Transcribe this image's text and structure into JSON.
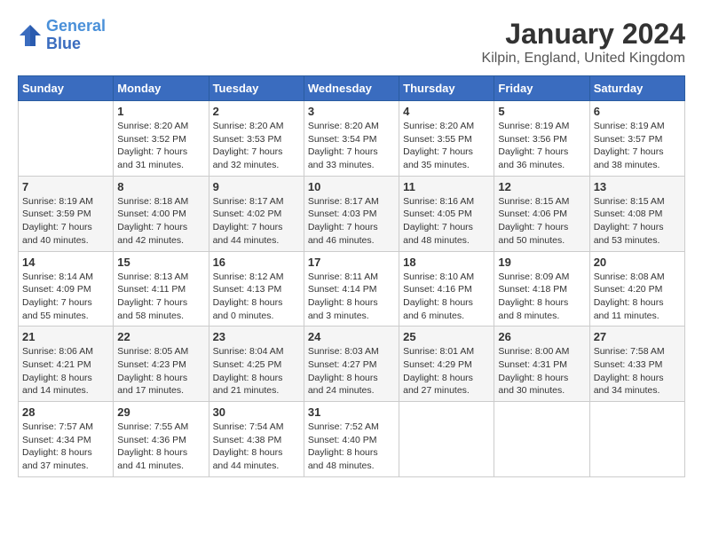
{
  "logo": {
    "line1": "General",
    "line2": "Blue"
  },
  "title": "January 2024",
  "subtitle": "Kilpin, England, United Kingdom",
  "days_of_week": [
    "Sunday",
    "Monday",
    "Tuesday",
    "Wednesday",
    "Thursday",
    "Friday",
    "Saturday"
  ],
  "weeks": [
    [
      {
        "day": "",
        "info": ""
      },
      {
        "day": "1",
        "info": "Sunrise: 8:20 AM\nSunset: 3:52 PM\nDaylight: 7 hours\nand 31 minutes."
      },
      {
        "day": "2",
        "info": "Sunrise: 8:20 AM\nSunset: 3:53 PM\nDaylight: 7 hours\nand 32 minutes."
      },
      {
        "day": "3",
        "info": "Sunrise: 8:20 AM\nSunset: 3:54 PM\nDaylight: 7 hours\nand 33 minutes."
      },
      {
        "day": "4",
        "info": "Sunrise: 8:20 AM\nSunset: 3:55 PM\nDaylight: 7 hours\nand 35 minutes."
      },
      {
        "day": "5",
        "info": "Sunrise: 8:19 AM\nSunset: 3:56 PM\nDaylight: 7 hours\nand 36 minutes."
      },
      {
        "day": "6",
        "info": "Sunrise: 8:19 AM\nSunset: 3:57 PM\nDaylight: 7 hours\nand 38 minutes."
      }
    ],
    [
      {
        "day": "7",
        "info": "Sunrise: 8:19 AM\nSunset: 3:59 PM\nDaylight: 7 hours\nand 40 minutes."
      },
      {
        "day": "8",
        "info": "Sunrise: 8:18 AM\nSunset: 4:00 PM\nDaylight: 7 hours\nand 42 minutes."
      },
      {
        "day": "9",
        "info": "Sunrise: 8:17 AM\nSunset: 4:02 PM\nDaylight: 7 hours\nand 44 minutes."
      },
      {
        "day": "10",
        "info": "Sunrise: 8:17 AM\nSunset: 4:03 PM\nDaylight: 7 hours\nand 46 minutes."
      },
      {
        "day": "11",
        "info": "Sunrise: 8:16 AM\nSunset: 4:05 PM\nDaylight: 7 hours\nand 48 minutes."
      },
      {
        "day": "12",
        "info": "Sunrise: 8:15 AM\nSunset: 4:06 PM\nDaylight: 7 hours\nand 50 minutes."
      },
      {
        "day": "13",
        "info": "Sunrise: 8:15 AM\nSunset: 4:08 PM\nDaylight: 7 hours\nand 53 minutes."
      }
    ],
    [
      {
        "day": "14",
        "info": "Sunrise: 8:14 AM\nSunset: 4:09 PM\nDaylight: 7 hours\nand 55 minutes."
      },
      {
        "day": "15",
        "info": "Sunrise: 8:13 AM\nSunset: 4:11 PM\nDaylight: 7 hours\nand 58 minutes."
      },
      {
        "day": "16",
        "info": "Sunrise: 8:12 AM\nSunset: 4:13 PM\nDaylight: 8 hours\nand 0 minutes."
      },
      {
        "day": "17",
        "info": "Sunrise: 8:11 AM\nSunset: 4:14 PM\nDaylight: 8 hours\nand 3 minutes."
      },
      {
        "day": "18",
        "info": "Sunrise: 8:10 AM\nSunset: 4:16 PM\nDaylight: 8 hours\nand 6 minutes."
      },
      {
        "day": "19",
        "info": "Sunrise: 8:09 AM\nSunset: 4:18 PM\nDaylight: 8 hours\nand 8 minutes."
      },
      {
        "day": "20",
        "info": "Sunrise: 8:08 AM\nSunset: 4:20 PM\nDaylight: 8 hours\nand 11 minutes."
      }
    ],
    [
      {
        "day": "21",
        "info": "Sunrise: 8:06 AM\nSunset: 4:21 PM\nDaylight: 8 hours\nand 14 minutes."
      },
      {
        "day": "22",
        "info": "Sunrise: 8:05 AM\nSunset: 4:23 PM\nDaylight: 8 hours\nand 17 minutes."
      },
      {
        "day": "23",
        "info": "Sunrise: 8:04 AM\nSunset: 4:25 PM\nDaylight: 8 hours\nand 21 minutes."
      },
      {
        "day": "24",
        "info": "Sunrise: 8:03 AM\nSunset: 4:27 PM\nDaylight: 8 hours\nand 24 minutes."
      },
      {
        "day": "25",
        "info": "Sunrise: 8:01 AM\nSunset: 4:29 PM\nDaylight: 8 hours\nand 27 minutes."
      },
      {
        "day": "26",
        "info": "Sunrise: 8:00 AM\nSunset: 4:31 PM\nDaylight: 8 hours\nand 30 minutes."
      },
      {
        "day": "27",
        "info": "Sunrise: 7:58 AM\nSunset: 4:33 PM\nDaylight: 8 hours\nand 34 minutes."
      }
    ],
    [
      {
        "day": "28",
        "info": "Sunrise: 7:57 AM\nSunset: 4:34 PM\nDaylight: 8 hours\nand 37 minutes."
      },
      {
        "day": "29",
        "info": "Sunrise: 7:55 AM\nSunset: 4:36 PM\nDaylight: 8 hours\nand 41 minutes."
      },
      {
        "day": "30",
        "info": "Sunrise: 7:54 AM\nSunset: 4:38 PM\nDaylight: 8 hours\nand 44 minutes."
      },
      {
        "day": "31",
        "info": "Sunrise: 7:52 AM\nSunset: 4:40 PM\nDaylight: 8 hours\nand 48 minutes."
      },
      {
        "day": "",
        "info": ""
      },
      {
        "day": "",
        "info": ""
      },
      {
        "day": "",
        "info": ""
      }
    ]
  ]
}
